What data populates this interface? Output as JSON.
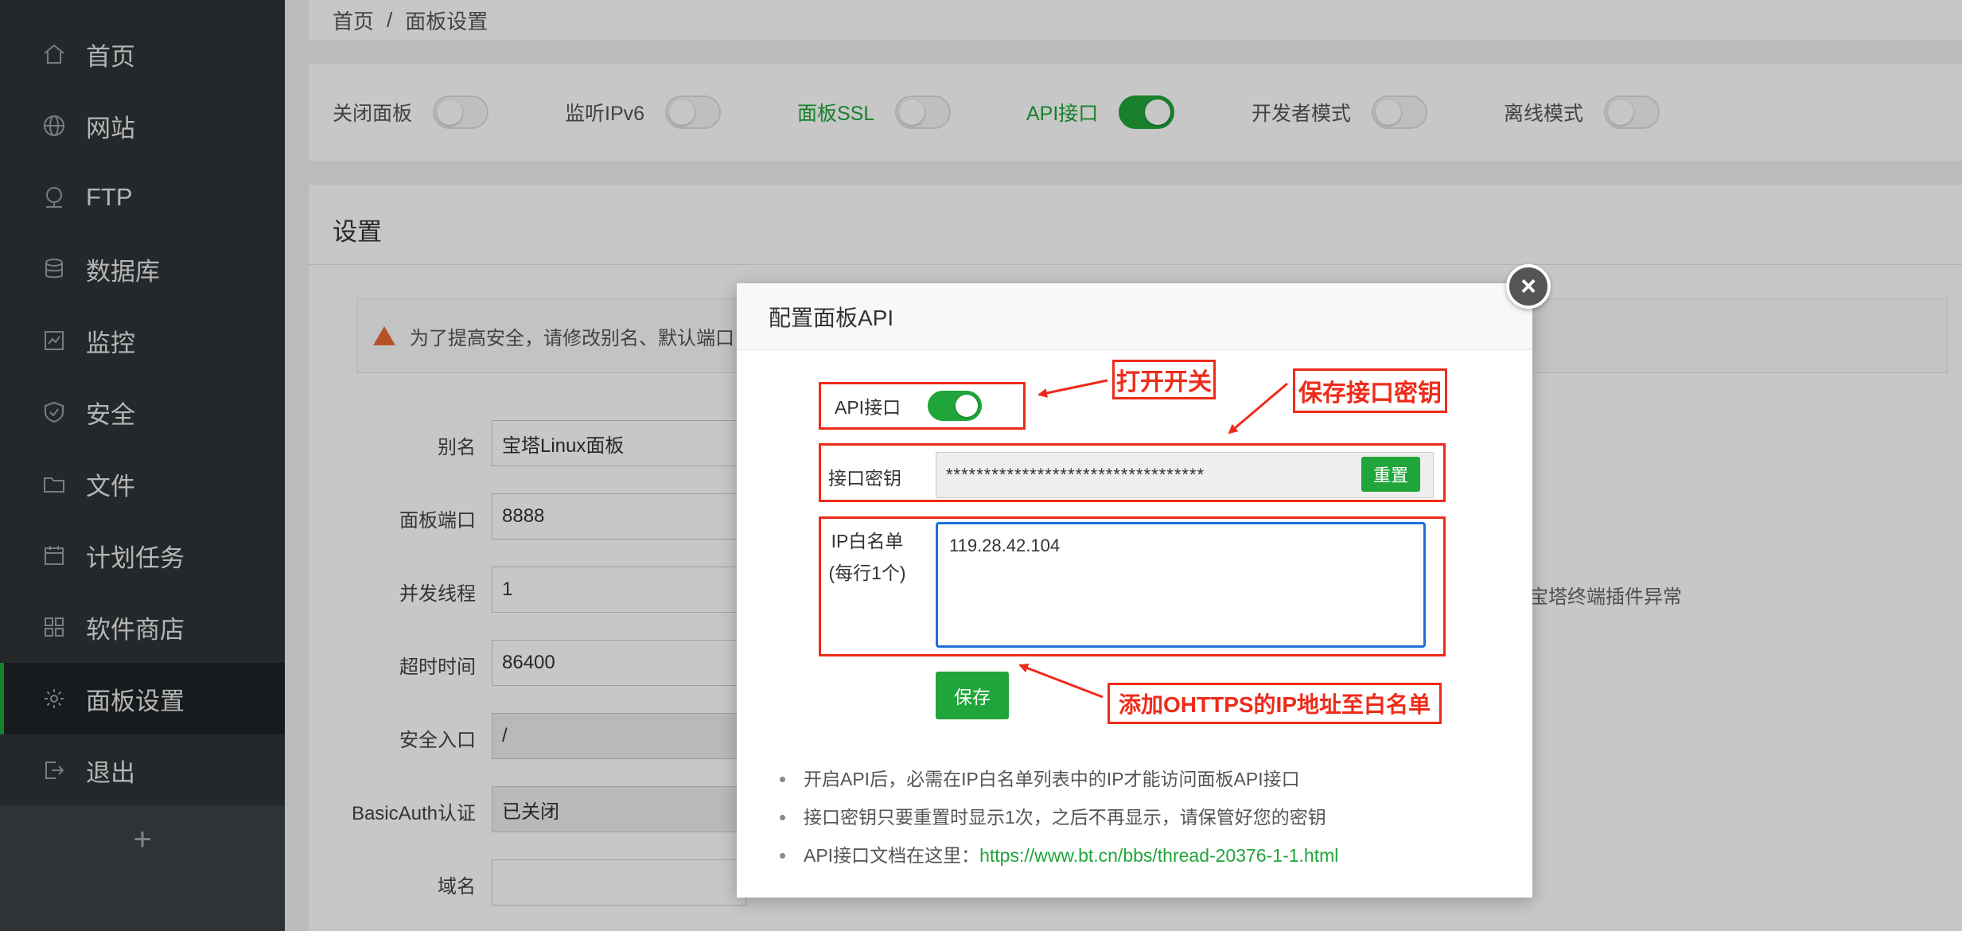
{
  "sidebar": {
    "items": [
      {
        "label": "首页",
        "icon": "home-icon"
      },
      {
        "label": "网站",
        "icon": "globe-icon"
      },
      {
        "label": "FTP",
        "icon": "ftp-icon"
      },
      {
        "label": "数据库",
        "icon": "database-icon"
      },
      {
        "label": "监控",
        "icon": "monitor-icon"
      },
      {
        "label": "安全",
        "icon": "shield-icon"
      },
      {
        "label": "文件",
        "icon": "folder-icon"
      },
      {
        "label": "计划任务",
        "icon": "calendar-icon"
      },
      {
        "label": "软件商店",
        "icon": "apps-icon"
      },
      {
        "label": "面板设置",
        "icon": "gear-icon"
      },
      {
        "label": "退出",
        "icon": "logout-icon"
      }
    ],
    "active_index": 9,
    "add_label": "+"
  },
  "breadcrumb": {
    "home": "首页",
    "separator": "/",
    "current": "面板设置"
  },
  "toggles": [
    {
      "label": "关闭面板",
      "on": false
    },
    {
      "label": "监听IPv6",
      "on": false
    },
    {
      "label": "面板SSL",
      "on": false
    },
    {
      "label": "API接口",
      "on": true
    },
    {
      "label": "开发者模式",
      "on": false
    },
    {
      "label": "离线模式",
      "on": false
    }
  ],
  "settings": {
    "title": "设置",
    "warning": "为了提高安全，请修改别名、默认端口",
    "fields": [
      {
        "label": "别名",
        "value": "宝塔Linux面板"
      },
      {
        "label": "面板端口",
        "value": "8888"
      },
      {
        "label": "并发线程",
        "value": "1"
      },
      {
        "label": "超时时间",
        "value": "86400"
      },
      {
        "label": "安全入口",
        "value": "/"
      },
      {
        "label": "BasicAuth认证",
        "value": "已关闭"
      },
      {
        "label": "域名",
        "value": ""
      }
    ],
    "side_note": "宝塔终端插件异常"
  },
  "modal": {
    "title": "配置面板API",
    "close": "×",
    "api_label": "API接口",
    "api_on": true,
    "key_label": "接口密钥",
    "key_value": "**********************************",
    "reset_label": "重置",
    "ip_label_line1": "IP白名单",
    "ip_label_line2": "(每行1个)",
    "ip_value": "119.28.42.104",
    "save_label": "保存",
    "notes": [
      "开启API后，必需在IP白名单列表中的IP才能访问面板API接口",
      "接口密钥只要重置时显示1次，之后不再显示，请保管好您的密钥",
      "API接口文档在这里："
    ],
    "doc_link": "https://www.bt.cn/bbs/thread-20376-1-1.html"
  },
  "annotations": {
    "open_switch": "打开开关",
    "save_key": "保存接口密钥",
    "add_ip": "添加OHTTPS的IP地址至白名单"
  },
  "colors": {
    "accent": "#20a53a",
    "annotation": "#ee2b1a",
    "focus": "#1e6fd9"
  }
}
